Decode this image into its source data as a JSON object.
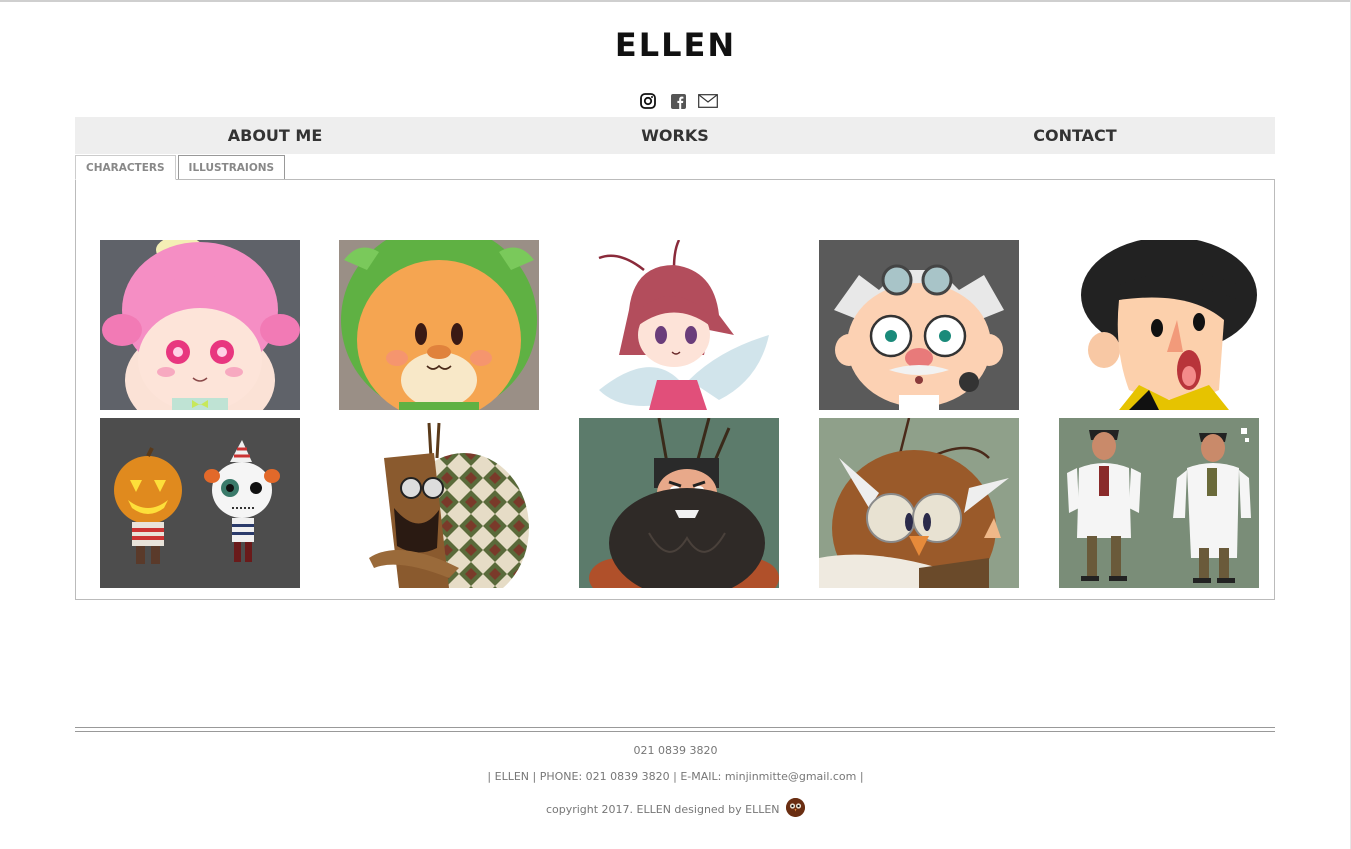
{
  "site": {
    "title": "ELLEN"
  },
  "social": [
    {
      "name": "instagram-icon"
    },
    {
      "name": "facebook-icon"
    },
    {
      "name": "mail-icon"
    }
  ],
  "nav": {
    "about": "ABOUT ME",
    "works": "WORKS",
    "contact": "CONTACT"
  },
  "tabs": {
    "characters": "CHARACTERS",
    "illustrations": "ILLUSTRAIONS",
    "active": "characters"
  },
  "gallery": {
    "items": [
      {
        "name": "pink-hair-girl",
        "bg": "#5f6269"
      },
      {
        "name": "orange-bear",
        "bg": "#9a8f86"
      },
      {
        "name": "fairy-girl",
        "bg": "#ffffff"
      },
      {
        "name": "goggle-scientist",
        "bg": "#5a5a5a"
      },
      {
        "name": "screaming-boy",
        "bg": "#ffffff"
      },
      {
        "name": "pumpkin-and-skull",
        "bg": "#4d4d4d"
      },
      {
        "name": "argyle-bug",
        "bg": "#ffffff"
      },
      {
        "name": "bearded-bug",
        "bg": "#5c7b6b"
      },
      {
        "name": "owl-professor",
        "bg": "#8fa08a"
      },
      {
        "name": "two-doctors",
        "bg": "#7a8d78"
      }
    ]
  },
  "footer": {
    "phone_line": "021 0839 3820",
    "info_line": "| ELLEN | PHONE: 021 0839 3820 | E-MAIL: minjinmitte@gmail.com |",
    "copyright": "copyright 2017. ELLEN designed by ELLEN"
  }
}
